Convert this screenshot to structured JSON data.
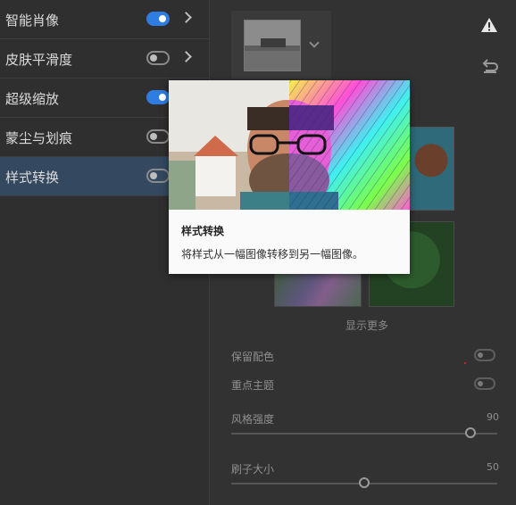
{
  "filters": [
    {
      "label": "智能肖像",
      "toggle": "on",
      "has_chevron": true
    },
    {
      "label": "皮肤平滑度",
      "toggle": "off",
      "has_chevron": true
    },
    {
      "label": "超级缩放",
      "toggle": "on",
      "has_chevron": false
    },
    {
      "label": "蒙尘与划痕",
      "toggle": "off",
      "has_chevron": false
    },
    {
      "label": "样式转换",
      "toggle": "off",
      "has_chevron": false,
      "selected": true
    }
  ],
  "tooltip": {
    "title": "样式转换",
    "description": "将样式从一幅图像转移到另一幅图像。"
  },
  "right_panel": {
    "show_more": "显示更多",
    "options": {
      "preserve_color_label": "保留配色",
      "focus_subject_label": "重点主题"
    },
    "sliders": {
      "style_strength": {
        "label": "风格强度",
        "value": "90",
        "fraction": 0.9
      },
      "brush_size": {
        "label": "刷子大小",
        "value": "50",
        "fraction": 0.5
      }
    }
  },
  "icons": [
    "toggle-icon",
    "chevron-right-icon",
    "chevron-down-icon",
    "warning-icon",
    "undo-icon"
  ],
  "colors": {
    "accent": "#2f7de1",
    "selected_row": "#34495f",
    "panel_bg": "#2f2f2f"
  }
}
